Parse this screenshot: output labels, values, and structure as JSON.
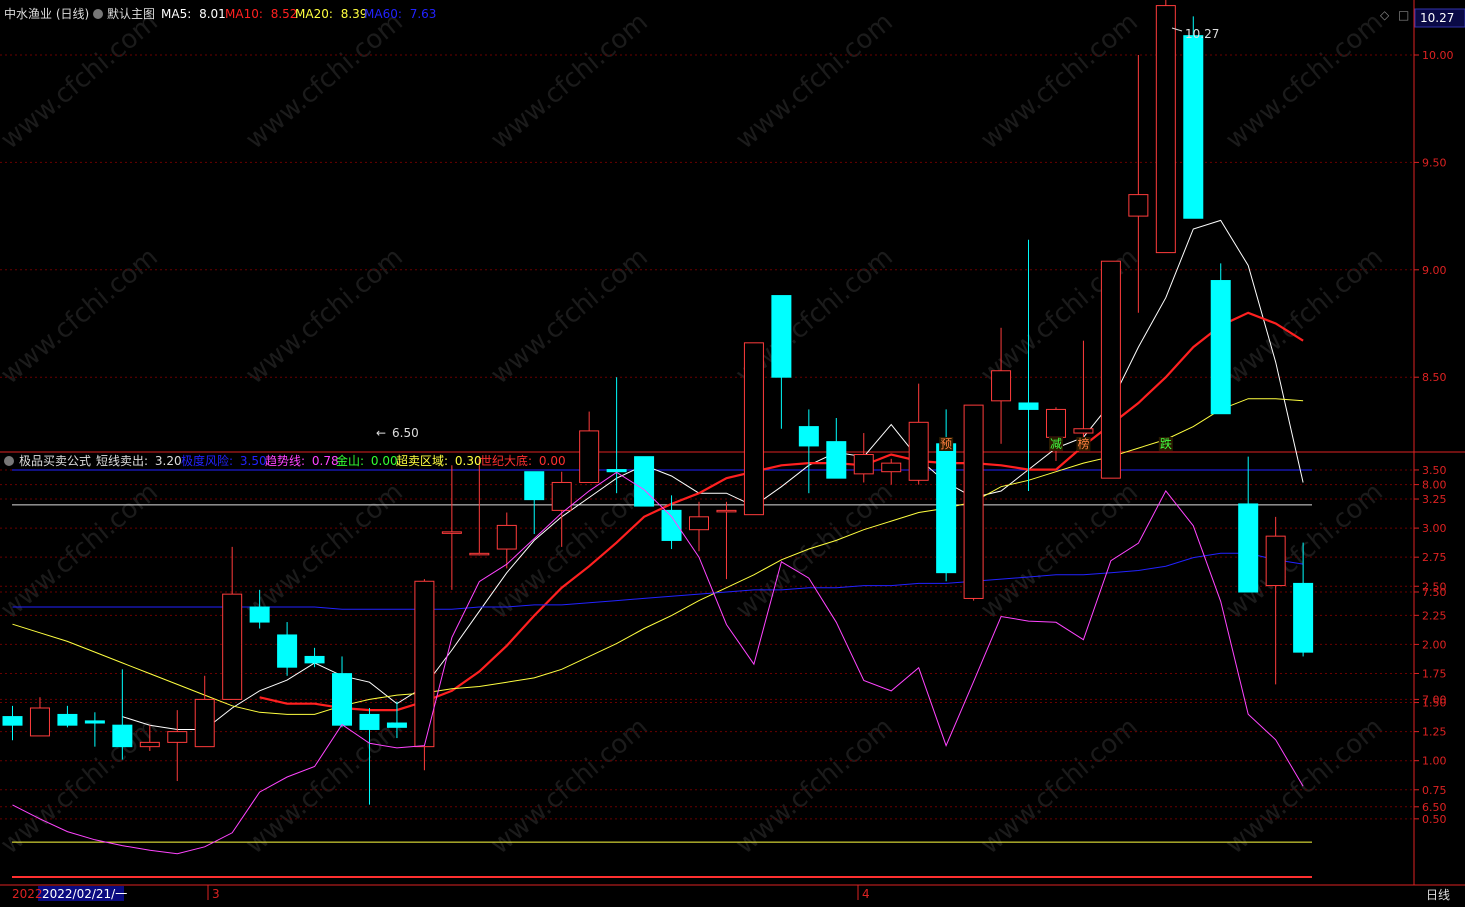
{
  "header_main": {
    "stock": "中水渔业 (日线)",
    "template": "默认主图",
    "ma5": {
      "label": "MA5:",
      "value": "8.01",
      "color": "#ffffff"
    },
    "ma10": {
      "label": "MA10:",
      "value": "8.52",
      "color": "#ff2020"
    },
    "ma20": {
      "label": "MA20:",
      "value": "8.39",
      "color": "#ffff40"
    },
    "ma60": {
      "label": "MA60:",
      "value": "7.63",
      "color": "#2222ff"
    }
  },
  "header_sub": {
    "name": "极品买卖公式",
    "short_sell": {
      "label": "短线卖出:",
      "value": "3.20",
      "color": "#dddddd"
    },
    "extreme_risk": {
      "label": "极度风险:",
      "value": "3.50",
      "color": "#2222ff"
    },
    "trend": {
      "label": "趋势线:",
      "value": "0.78",
      "color": "#ff44ff"
    },
    "gold_mountain": {
      "label": "金山:",
      "value": "0.00",
      "color": "#33ff33"
    },
    "oversold": {
      "label": "超卖区域:",
      "value": "0.30",
      "color": "#ffff40"
    },
    "century_bottom": {
      "label": "世纪大底:",
      "value": "0.00",
      "color": "#ff3030"
    }
  },
  "price_tag": "10.27",
  "timeframe": "日线",
  "date_box": "2022/02/21/一",
  "year_label": "2022",
  "month_marks": [
    "3",
    "4"
  ],
  "annotations": {
    "high": "10.27",
    "low": "6.50"
  },
  "signals": [
    {
      "text": "预",
      "index": 34,
      "color": "#ff8040"
    },
    {
      "text": "减",
      "index": 38,
      "color": "#40ff40"
    },
    {
      "text": "榜",
      "index": 39,
      "color": "#ff8040"
    },
    {
      "text": "跌",
      "index": 42,
      "color": "#40ff40"
    }
  ],
  "watermark": "www.cfchi.com",
  "chart_data": [
    {
      "type": "candlestick",
      "ylim": [
        6.3,
        10.42
      ],
      "y_ticks": [
        "10.00",
        "9.50",
        "9.00",
        "8.50",
        "8.00",
        "7.50",
        "7.00",
        "6.50"
      ],
      "up_color": "#ff3c3c",
      "down_color": "#00ffff",
      "candles": [
        {
          "o": 6.92,
          "h": 6.97,
          "l": 6.81,
          "c": 6.88
        },
        {
          "o": 6.83,
          "h": 7.01,
          "l": 6.83,
          "c": 6.96
        },
        {
          "o": 6.93,
          "h": 6.97,
          "l": 6.87,
          "c": 6.88
        },
        {
          "o": 6.9,
          "h": 6.94,
          "l": 6.78,
          "c": 6.89
        },
        {
          "o": 6.88,
          "h": 7.14,
          "l": 6.72,
          "c": 6.78
        },
        {
          "o": 6.78,
          "h": 6.88,
          "l": 6.76,
          "c": 6.8
        },
        {
          "o": 6.8,
          "h": 6.95,
          "l": 6.62,
          "c": 6.85
        },
        {
          "o": 6.78,
          "h": 7.11,
          "l": 6.78,
          "c": 7.0
        },
        {
          "o": 7.0,
          "h": 7.71,
          "l": 7.0,
          "c": 7.49
        },
        {
          "o": 7.43,
          "h": 7.51,
          "l": 7.33,
          "c": 7.36
        },
        {
          "o": 7.3,
          "h": 7.36,
          "l": 7.11,
          "c": 7.15
        },
        {
          "o": 7.2,
          "h": 7.24,
          "l": 7.15,
          "c": 7.17
        },
        {
          "o": 7.12,
          "h": 7.2,
          "l": 6.87,
          "c": 6.88
        },
        {
          "o": 6.93,
          "h": 6.96,
          "l": 6.51,
          "c": 6.86
        },
        {
          "o": 6.89,
          "h": 6.99,
          "l": 6.82,
          "c": 6.87
        },
        {
          "o": 6.78,
          "h": 7.56,
          "l": 6.67,
          "c": 7.55
        },
        {
          "o": 7.78,
          "h": 8.09,
          "l": 7.51,
          "c": 7.78
        },
        {
          "o": 7.68,
          "h": 8.12,
          "l": 7.67,
          "c": 7.68
        },
        {
          "o": 7.7,
          "h": 7.87,
          "l": 7.61,
          "c": 7.81
        },
        {
          "o": 8.06,
          "h": 8.06,
          "l": 7.77,
          "c": 7.93
        },
        {
          "o": 7.88,
          "h": 8.06,
          "l": 7.71,
          "c": 8.01
        },
        {
          "o": 8.01,
          "h": 8.34,
          "l": 8.01,
          "c": 8.25
        },
        {
          "o": 8.07,
          "h": 8.5,
          "l": 7.96,
          "c": 8.06
        },
        {
          "o": 8.13,
          "h": 8.13,
          "l": 7.9,
          "c": 7.9
        },
        {
          "o": 7.88,
          "h": 7.95,
          "l": 7.7,
          "c": 7.74
        },
        {
          "o": 7.79,
          "h": 7.92,
          "l": 7.69,
          "c": 7.85
        },
        {
          "o": 7.88,
          "h": 7.92,
          "l": 7.56,
          "c": 7.88
        },
        {
          "o": 7.86,
          "h": 8.66,
          "l": 7.86,
          "c": 8.66
        },
        {
          "o": 8.88,
          "h": 8.88,
          "l": 8.26,
          "c": 8.5
        },
        {
          "o": 8.27,
          "h": 8.35,
          "l": 7.96,
          "c": 8.18
        },
        {
          "o": 8.2,
          "h": 8.31,
          "l": 8.05,
          "c": 8.03
        },
        {
          "o": 8.05,
          "h": 8.24,
          "l": 8.01,
          "c": 8.14
        },
        {
          "o": 8.06,
          "h": 8.12,
          "l": 8.0,
          "c": 8.1
        },
        {
          "o": 8.02,
          "h": 8.47,
          "l": 8.0,
          "c": 8.29
        },
        {
          "o": 8.19,
          "h": 8.35,
          "l": 7.55,
          "c": 7.59
        },
        {
          "o": 7.47,
          "h": 8.37,
          "l": 7.46,
          "c": 8.37
        },
        {
          "o": 8.39,
          "h": 8.73,
          "l": 8.19,
          "c": 8.53
        },
        {
          "o": 8.38,
          "h": 9.14,
          "l": 7.97,
          "c": 8.35
        },
        {
          "o": 8.22,
          "h": 8.36,
          "l": 8.11,
          "c": 8.35
        },
        {
          "o": 8.24,
          "h": 8.67,
          "l": 8.21,
          "c": 8.26
        },
        {
          "o": 8.03,
          "h": 9.04,
          "l": 8.03,
          "c": 9.04
        },
        {
          "o": 9.25,
          "h": 10.0,
          "l": 8.8,
          "c": 9.35
        },
        {
          "o": 9.08,
          "h": 10.27,
          "l": 9.08,
          "c": 10.23
        },
        {
          "o": 10.09,
          "h": 10.18,
          "l": 9.24,
          "c": 9.24
        },
        {
          "o": 8.95,
          "h": 9.03,
          "l": 8.33,
          "c": 8.33
        },
        {
          "o": 7.91,
          "h": 8.13,
          "l": 7.5,
          "c": 7.5
        },
        {
          "o": 7.53,
          "h": 7.85,
          "l": 7.07,
          "c": 7.76
        },
        {
          "o": 7.54,
          "h": 7.73,
          "l": 7.2,
          "c": 7.22
        }
      ],
      "series": [
        {
          "name": "MA5",
          "color": "#ffffff",
          "values": [
            null,
            null,
            null,
            null,
            6.92,
            6.88,
            6.86,
            6.86,
            6.96,
            7.04,
            7.09,
            7.17,
            7.11,
            7.08,
            6.98,
            7.06,
            7.23,
            7.41,
            7.59,
            7.74,
            7.85,
            7.94,
            8.03,
            8.09,
            8.04,
            7.96,
            7.96,
            7.9,
            7.99,
            8.09,
            8.15,
            8.13,
            8.28,
            8.12,
            8.01,
            7.94,
            7.97,
            8.07,
            8.17,
            8.22,
            8.38,
            8.64,
            8.87,
            9.19,
            9.23,
            9.02,
            8.57,
            8.01
          ]
        },
        {
          "name": "MA10",
          "color": "#ff2020",
          "values": [
            null,
            null,
            null,
            null,
            null,
            null,
            null,
            null,
            null,
            7.01,
            6.98,
            6.98,
            6.96,
            6.95,
            6.95,
            6.99,
            7.04,
            7.13,
            7.25,
            7.39,
            7.52,
            7.62,
            7.73,
            7.85,
            7.91,
            7.96,
            8.03,
            8.06,
            8.09,
            8.1,
            8.1,
            8.09,
            8.14,
            8.11,
            8.1,
            8.1,
            8.09,
            8.07,
            8.07,
            8.18,
            8.28,
            8.38,
            8.5,
            8.64,
            8.74,
            8.8,
            8.75,
            8.67
          ]
        },
        {
          "name": "MA20",
          "color": "#ffff40",
          "values": [
            7.35,
            7.31,
            7.27,
            7.22,
            7.17,
            7.12,
            7.07,
            7.02,
            6.97,
            6.94,
            6.93,
            6.93,
            6.97,
            7.0,
            7.02,
            7.03,
            7.05,
            7.06,
            7.08,
            7.1,
            7.14,
            7.2,
            7.26,
            7.33,
            7.39,
            7.46,
            7.52,
            7.58,
            7.65,
            7.7,
            7.74,
            7.79,
            7.83,
            7.87,
            7.89,
            7.92,
            7.99,
            8.02,
            8.06,
            8.1,
            8.13,
            8.17,
            8.21,
            8.27,
            8.35,
            8.4,
            8.4,
            8.39
          ]
        },
        {
          "name": "MA60",
          "color": "#2222ff",
          "values": [
            7.43,
            7.43,
            7.43,
            7.43,
            7.43,
            7.43,
            7.43,
            7.43,
            7.43,
            7.43,
            7.43,
            7.43,
            7.42,
            7.42,
            7.42,
            7.42,
            7.42,
            7.43,
            7.43,
            7.44,
            7.44,
            7.45,
            7.46,
            7.47,
            7.48,
            7.49,
            7.5,
            7.51,
            7.51,
            7.52,
            7.52,
            7.53,
            7.53,
            7.54,
            7.54,
            7.55,
            7.56,
            7.57,
            7.58,
            7.58,
            7.59,
            7.6,
            7.62,
            7.66,
            7.68,
            7.68,
            7.65,
            7.63
          ]
        }
      ]
    },
    {
      "type": "line",
      "ylim": [
        0.0,
        3.7
      ],
      "y_ticks": [
        "3.50",
        "3.25",
        "3.00",
        "2.75",
        "2.50",
        "2.25",
        "2.00",
        "1.75",
        "1.50",
        "1.25",
        "1.00",
        "0.75",
        "0.50"
      ],
      "hlines": [
        {
          "name": "极度风险",
          "value": 3.5,
          "color": "#2222ff"
        },
        {
          "name": "短线卖出",
          "value": 3.2,
          "color": "#dddddd"
        },
        {
          "name": "超卖区域",
          "value": 0.3,
          "color": "#ffff40"
        },
        {
          "name": "世纪大底",
          "value": 0.0,
          "color": "#ff3030"
        }
      ],
      "series": [
        {
          "name": "趋势线",
          "color": "#ff44ff",
          "values": [
            0.62,
            0.5,
            0.39,
            0.32,
            0.27,
            0.23,
            0.2,
            0.26,
            0.38,
            0.73,
            0.86,
            0.95,
            1.31,
            1.15,
            1.11,
            1.13,
            2.06,
            2.54,
            2.69,
            2.91,
            3.13,
            3.32,
            3.48,
            3.33,
            3.1,
            2.75,
            2.17,
            1.83,
            2.71,
            2.57,
            2.19,
            1.69,
            1.6,
            1.8,
            1.13,
            1.68,
            2.24,
            2.2,
            2.19,
            2.04,
            2.72,
            2.87,
            3.32,
            3.02,
            2.37,
            1.4,
            1.18,
            0.78
          ]
        }
      ]
    }
  ]
}
